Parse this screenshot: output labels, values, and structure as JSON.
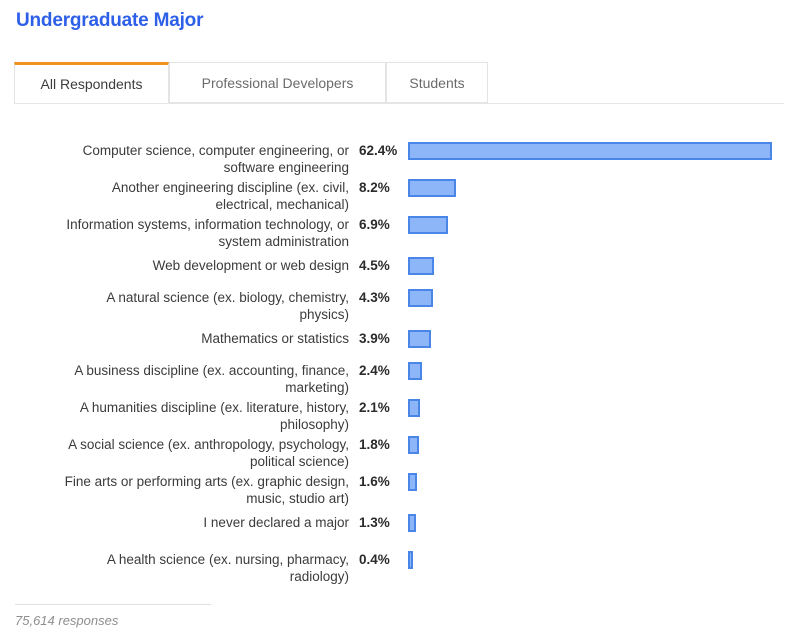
{
  "header": {
    "title": "Undergraduate Major"
  },
  "tabs": [
    {
      "label": "All Respondents",
      "active": true
    },
    {
      "label": "Professional Developers",
      "active": false
    },
    {
      "label": "Students",
      "active": false
    }
  ],
  "footer": {
    "responses": "75,614 responses"
  },
  "colors": {
    "title": "#2d5fe8",
    "active_tab_accent": "#f0921e",
    "bar_fill": "#8cb6f7",
    "bar_border": "#4a86e8",
    "tab_border": "#e4e4e4",
    "label_text": "#3b3b3b",
    "footer_text": "#8e8e8e"
  },
  "chart_data": {
    "type": "bar",
    "title": "Undergraduate Major",
    "orientation": "horizontal",
    "xlabel": "",
    "ylabel": "",
    "xlim": [
      0,
      62.4
    ],
    "grid": false,
    "legend": "none",
    "value_suffix": "%",
    "categories": [
      "Computer science, computer engineering, or software engineering",
      "Another engineering discipline (ex. civil, electrical, mechanical)",
      "Information systems, information technology, or system administration",
      "Web development or web design",
      "A natural science (ex. biology, chemistry, physics)",
      "Mathematics or statistics",
      "A business discipline (ex. accounting, finance, marketing)",
      "A humanities discipline (ex. literature, history, philosophy)",
      "A social science (ex. anthropology, psychology, political science)",
      "Fine arts or performing arts (ex. graphic design, music, studio art)",
      "I never declared a major",
      "A health science (ex. nursing, pharmacy, radiology)"
    ],
    "values": [
      62.4,
      8.2,
      6.9,
      4.5,
      4.3,
      3.9,
      2.4,
      2.1,
      1.8,
      1.6,
      1.3,
      0.4
    ],
    "value_labels": [
      "62.4%",
      "8.2%",
      "6.9%",
      "4.5%",
      "4.3%",
      "3.9%",
      "2.4%",
      "2.1%",
      "1.8%",
      "1.6%",
      "1.3%",
      "0.4%"
    ],
    "category_lines": [
      [
        "Computer science, computer engineering, or",
        "software engineering"
      ],
      [
        "Another engineering discipline (ex. civil,",
        "electrical, mechanical)"
      ],
      [
        "Information systems, information technology, or",
        "system administration"
      ],
      [
        "Web development or web design"
      ],
      [
        "A natural science (ex. biology, chemistry,",
        "physics)"
      ],
      [
        "Mathematics or statistics"
      ],
      [
        "A business discipline (ex. accounting, finance,",
        "marketing)"
      ],
      [
        "A humanities discipline (ex. literature, history,",
        "philosophy)"
      ],
      [
        "A social science (ex. anthropology, psychology,",
        "political science)"
      ],
      [
        "Fine arts or performing arts (ex. graphic design,",
        "music, studio art)"
      ],
      [
        "I never declared a major"
      ],
      [
        "A health science (ex. nursing, pharmacy,",
        "radiology)"
      ]
    ],
    "annotation": "75,614 responses"
  }
}
